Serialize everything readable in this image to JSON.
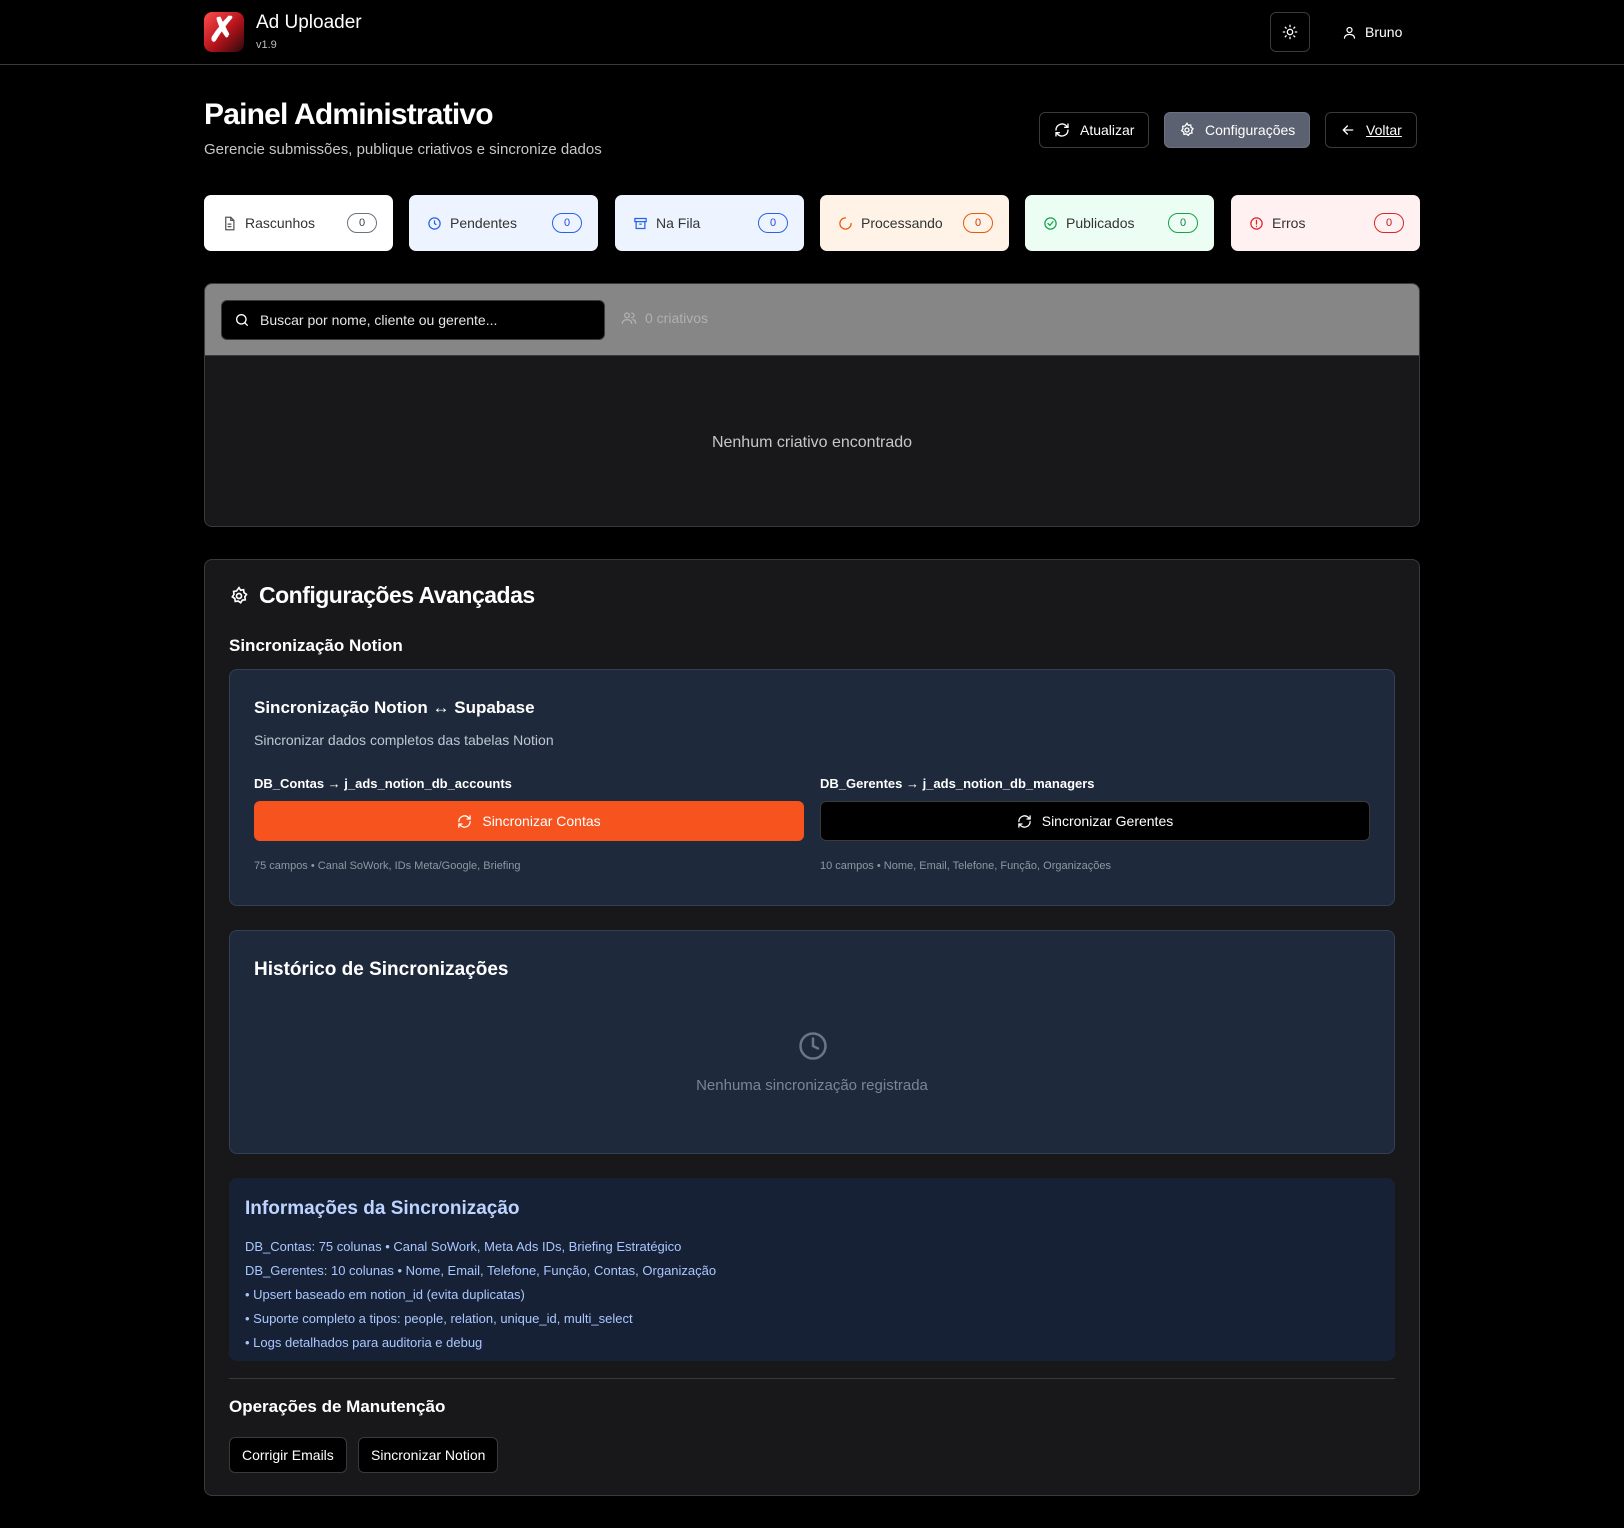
{
  "app": {
    "title": "Ad Uploader",
    "version": "v1.9",
    "user": "Bruno"
  },
  "page": {
    "title": "Painel Administrativo",
    "subtitle": "Gerencie submissões, publique criativos e sincronize dados"
  },
  "actions": {
    "refresh": "Atualizar",
    "settings": "Configurações",
    "back": "Voltar"
  },
  "status_cards": [
    {
      "label": "Rascunhos",
      "count": "0",
      "color": "#6b7280"
    },
    {
      "label": "Pendentes",
      "count": "0",
      "color": "#2563eb"
    },
    {
      "label": "Na Fila",
      "count": "0",
      "color": "#2563eb"
    },
    {
      "label": "Processando",
      "count": "0",
      "color": "#ea580c"
    },
    {
      "label": "Publicados",
      "count": "0",
      "color": "#16a34a"
    },
    {
      "label": "Erros",
      "count": "0",
      "color": "#dc2626"
    }
  ],
  "creatives": {
    "search_placeholder": "Buscar por nome, cliente ou gerente...",
    "count_label": "0 criativos",
    "empty": "Nenhum criativo encontrado"
  },
  "advanced": {
    "title": "Configurações Avançadas",
    "notion_section": "Sincronização Notion",
    "sync_box": {
      "title": "Sincronização Notion ↔ Supabase",
      "description": "Sincronizar dados completos das tabelas Notion",
      "accounts": {
        "heading": "DB_Contas → j_ads_notion_db_accounts",
        "button": "Sincronizar Contas",
        "note": "75 campos • Canal SoWork, IDs Meta/Google, Briefing"
      },
      "managers": {
        "heading": "DB_Gerentes → j_ads_notion_db_managers",
        "button": "Sincronizar Gerentes",
        "note": "10 campos • Nome, Email, Telefone, Função, Organizações"
      }
    },
    "history": {
      "title": "Histórico de Sincronizações",
      "empty": "Nenhuma sincronização registrada"
    },
    "info": {
      "title": "Informações da Sincronização",
      "lines": [
        "DB_Contas: 75 colunas • Canal SoWork, Meta Ads IDs, Briefing Estratégico",
        "DB_Gerentes: 10 colunas • Nome, Email, Telefone, Função, Contas, Organização",
        "• Upsert baseado em notion_id (evita duplicatas)",
        "• Suporte completo a tipos: people, relation, unique_id, multi_select",
        "• Logs detalhados para auditoria e debug"
      ]
    },
    "maintenance": {
      "title": "Operações de Manutenção",
      "fix_emails": "Corrigir Emails",
      "sync_notion": "Sincronizar Notion"
    }
  },
  "colors": {
    "accent": "#f6531f",
    "background": "#000000",
    "panel": "#18181b",
    "box": "#1e293b"
  }
}
